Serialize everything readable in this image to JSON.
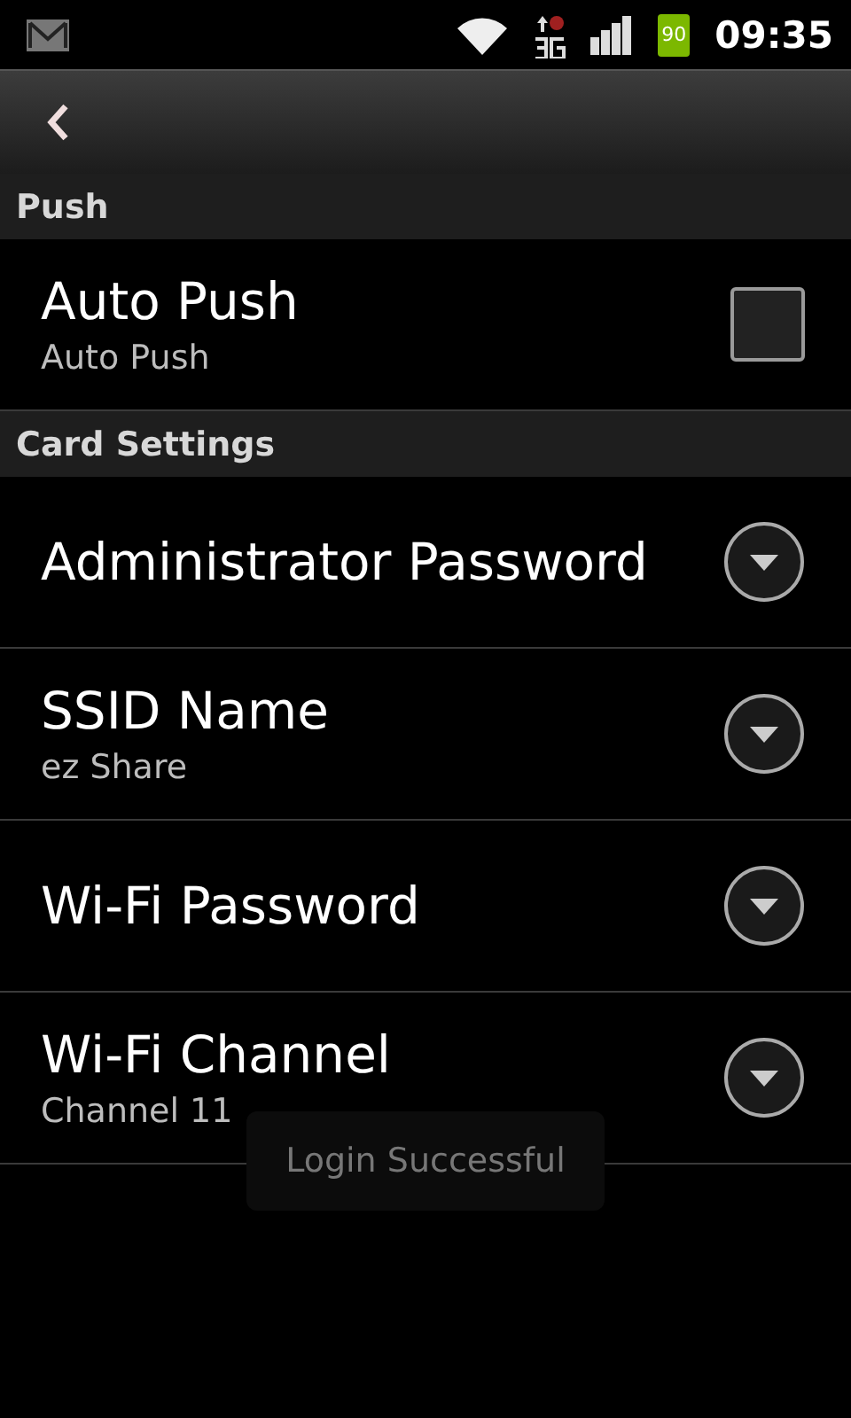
{
  "status_bar": {
    "battery": "90",
    "time": "09:35"
  },
  "sections": [
    {
      "title": "Push",
      "items": [
        {
          "kind": "checkbox",
          "title": "Auto Push",
          "summary": "Auto Push",
          "checked": false
        }
      ]
    },
    {
      "title": "Card Settings",
      "items": [
        {
          "kind": "dropdown",
          "title": "Administrator Password"
        },
        {
          "kind": "dropdown",
          "title": "SSID Name",
          "summary": "ez Share"
        },
        {
          "kind": "dropdown",
          "title": "Wi-Fi Password"
        },
        {
          "kind": "dropdown",
          "title": "Wi-Fi Channel",
          "summary": "Channel 11"
        }
      ]
    }
  ],
  "toast": {
    "text": "Login Successful"
  }
}
